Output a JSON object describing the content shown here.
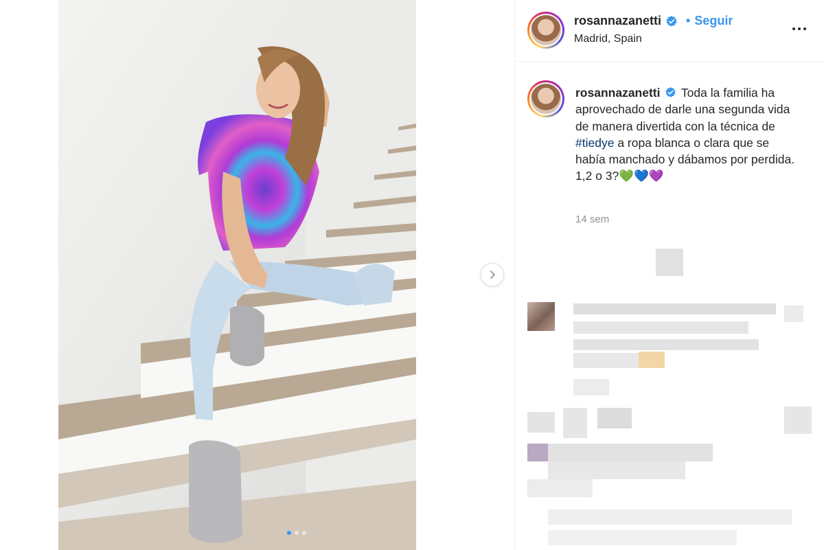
{
  "post": {
    "username": "rosannazanetti",
    "separator": "•",
    "follow_label": "Seguir",
    "location": "Madrid, Spain",
    "caption_username": "rosannazanetti",
    "caption_text_before": "Toda la familia ha aprovechado de darle una segunda vida de manera divertida con la técnica de",
    "caption_hashtag": "#tiedye",
    "caption_text_after": "a ropa blanca o clara que se había manchado y dábamos por perdida.",
    "caption_line_last": "1,2 o 3?💚💙💜",
    "timestamp": "14 sem"
  },
  "carousel": {
    "total_slides": 3,
    "active_slide": 1
  },
  "colors": {
    "accent_blue": "#3897f0",
    "hashtag": "#00376b",
    "text": "#262626",
    "muted": "#8e8e8e"
  },
  "icons": {
    "verified": "verified-badge-icon",
    "more": "more-options-icon",
    "next": "chevron-right-icon"
  }
}
